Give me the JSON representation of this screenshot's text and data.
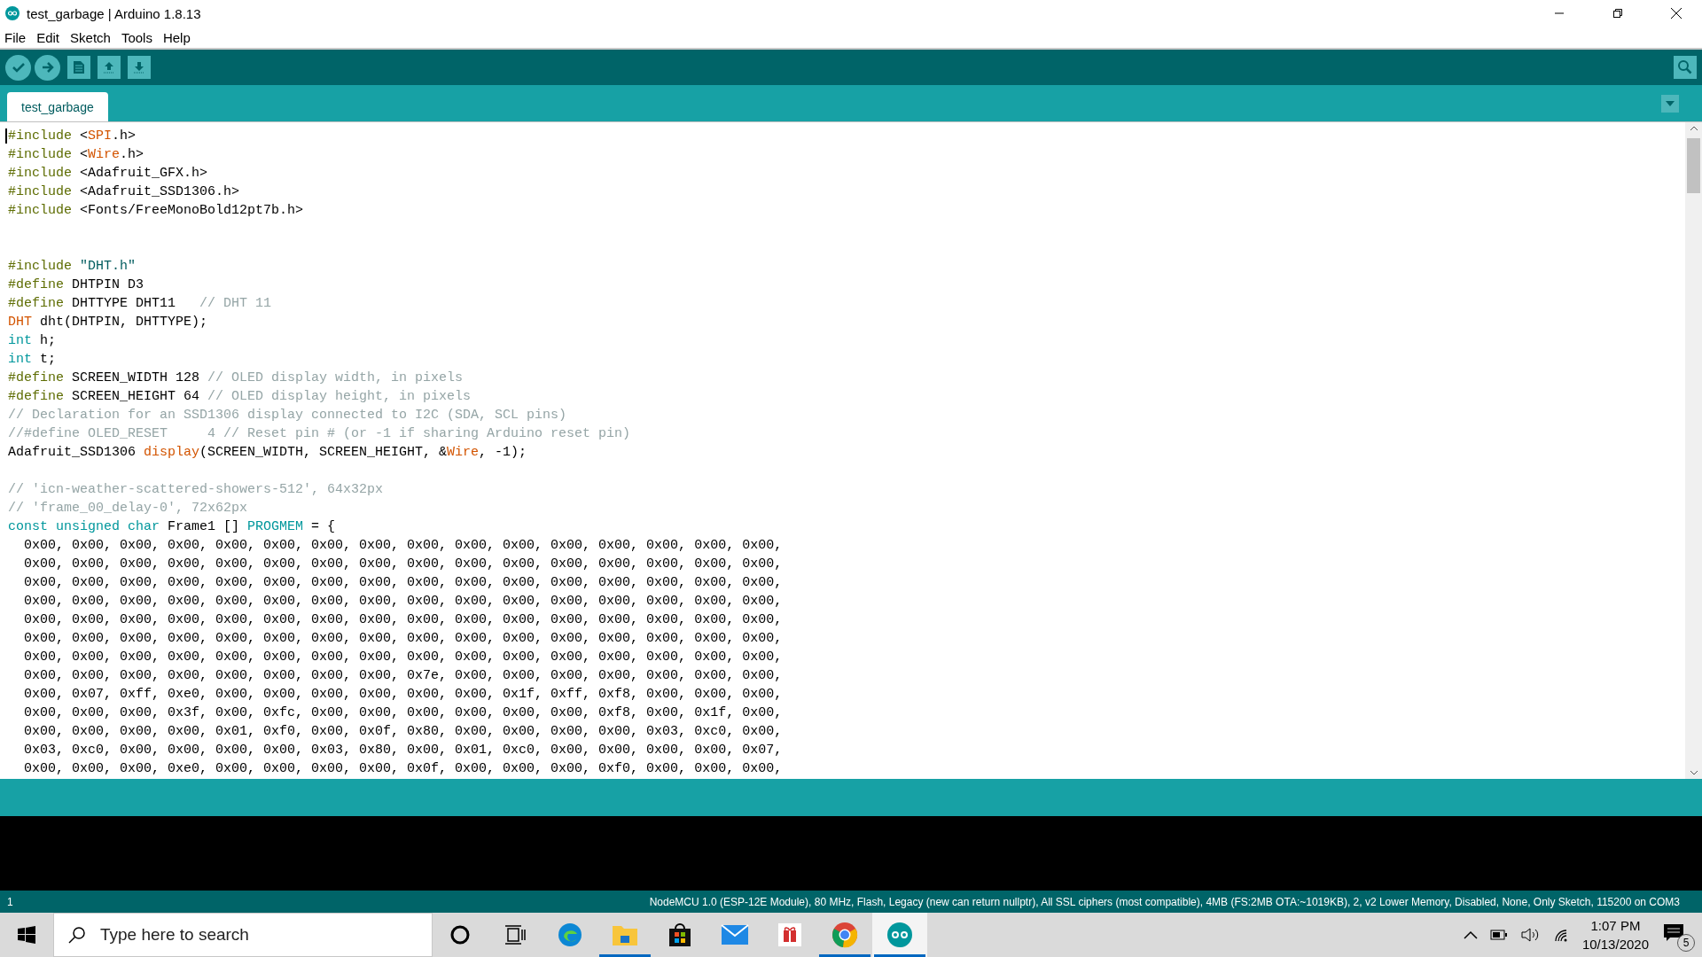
{
  "window": {
    "title": "test_garbage | Arduino 1.8.13"
  },
  "menu": [
    "File",
    "Edit",
    "Sketch",
    "Tools",
    "Help"
  ],
  "tabs": [
    {
      "label": "test_garbage",
      "selected": true
    }
  ],
  "editor": {
    "lines": [
      {
        "kind": "code",
        "tokens": [
          {
            "kind": "directive",
            "text": "#include"
          },
          {
            "kind": "plain",
            "text": " <"
          },
          {
            "kind": "lib",
            "text": "SPI"
          },
          {
            "kind": "plain",
            "text": ".h>"
          }
        ]
      },
      {
        "kind": "code",
        "tokens": [
          {
            "kind": "directive",
            "text": "#include"
          },
          {
            "kind": "plain",
            "text": " <"
          },
          {
            "kind": "lib",
            "text": "Wire"
          },
          {
            "kind": "plain",
            "text": ".h>"
          }
        ]
      },
      {
        "kind": "code",
        "tokens": [
          {
            "kind": "directive",
            "text": "#include"
          },
          {
            "kind": "plain",
            "text": " <Adafruit_GFX.h>"
          }
        ]
      },
      {
        "kind": "code",
        "tokens": [
          {
            "kind": "directive",
            "text": "#include"
          },
          {
            "kind": "plain",
            "text": " <Adafruit_SSD1306.h>"
          }
        ]
      },
      {
        "kind": "code",
        "tokens": [
          {
            "kind": "directive",
            "text": "#include"
          },
          {
            "kind": "plain",
            "text": " <Fonts/FreeMonoBold12pt7b.h>"
          }
        ]
      },
      {
        "kind": "blank"
      },
      {
        "kind": "blank"
      },
      {
        "kind": "code",
        "tokens": [
          {
            "kind": "directive",
            "text": "#include"
          },
          {
            "kind": "string",
            "text": " \"DHT.h\""
          }
        ]
      },
      {
        "kind": "code",
        "tokens": [
          {
            "kind": "directive",
            "text": "#define"
          },
          {
            "kind": "plain",
            "text": " DHTPIN D3"
          }
        ]
      },
      {
        "kind": "code",
        "tokens": [
          {
            "kind": "directive",
            "text": "#define"
          },
          {
            "kind": "plain",
            "text": " DHTTYPE DHT11   "
          },
          {
            "kind": "comment",
            "text": "// DHT 11"
          }
        ]
      },
      {
        "kind": "code",
        "tokens": [
          {
            "kind": "lib",
            "text": "DHT"
          },
          {
            "kind": "plain",
            "text": " dht(DHTPIN, DHTTYPE);"
          }
        ]
      },
      {
        "kind": "code",
        "tokens": [
          {
            "kind": "type",
            "text": "int"
          },
          {
            "kind": "plain",
            "text": " h;"
          }
        ]
      },
      {
        "kind": "code",
        "tokens": [
          {
            "kind": "type",
            "text": "int"
          },
          {
            "kind": "plain",
            "text": " t;"
          }
        ]
      },
      {
        "kind": "code",
        "tokens": [
          {
            "kind": "directive",
            "text": "#define"
          },
          {
            "kind": "plain",
            "text": " SCREEN_WIDTH 128 "
          },
          {
            "kind": "comment",
            "text": "// OLED display width, in pixels"
          }
        ]
      },
      {
        "kind": "code",
        "tokens": [
          {
            "kind": "directive",
            "text": "#define"
          },
          {
            "kind": "plain",
            "text": " SCREEN_HEIGHT 64 "
          },
          {
            "kind": "comment",
            "text": "// OLED display height, in pixels"
          }
        ]
      },
      {
        "kind": "code",
        "tokens": [
          {
            "kind": "comment",
            "text": "// Declaration for an SSD1306 display connected to I2C (SDA, SCL pins)"
          }
        ]
      },
      {
        "kind": "code",
        "tokens": [
          {
            "kind": "comment",
            "text": "//#define OLED_RESET     4 // Reset pin # (or -1 if sharing Arduino reset pin)"
          }
        ]
      },
      {
        "kind": "code",
        "tokens": [
          {
            "kind": "plain",
            "text": "Adafruit_SSD1306 "
          },
          {
            "kind": "lib",
            "text": "display"
          },
          {
            "kind": "plain",
            "text": "(SCREEN_WIDTH, SCREEN_HEIGHT, &"
          },
          {
            "kind": "lib",
            "text": "Wire"
          },
          {
            "kind": "plain",
            "text": ", -1);"
          }
        ]
      },
      {
        "kind": "blank"
      },
      {
        "kind": "code",
        "tokens": [
          {
            "kind": "comment",
            "text": "// 'icn-weather-scattered-showers-512', 64x32px"
          }
        ]
      },
      {
        "kind": "code",
        "tokens": [
          {
            "kind": "comment",
            "text": "// 'frame_00_delay-0', 72x62px"
          }
        ]
      },
      {
        "kind": "code",
        "tokens": [
          {
            "kind": "type",
            "text": "const unsigned char"
          },
          {
            "kind": "plain",
            "text": " Frame1 [] "
          },
          {
            "kind": "type",
            "text": "PROGMEM"
          },
          {
            "kind": "plain",
            "text": " = {"
          }
        ]
      },
      {
        "kind": "code",
        "tokens": [
          {
            "kind": "plain",
            "text": "  0x00, 0x00, 0x00, 0x00, 0x00, 0x00, 0x00, 0x00, 0x00, 0x00, 0x00, 0x00, 0x00, 0x00, 0x00, 0x00,"
          }
        ]
      },
      {
        "kind": "code",
        "tokens": [
          {
            "kind": "plain",
            "text": "  0x00, 0x00, 0x00, 0x00, 0x00, 0x00, 0x00, 0x00, 0x00, 0x00, 0x00, 0x00, 0x00, 0x00, 0x00, 0x00,"
          }
        ]
      },
      {
        "kind": "code",
        "tokens": [
          {
            "kind": "plain",
            "text": "  0x00, 0x00, 0x00, 0x00, 0x00, 0x00, 0x00, 0x00, 0x00, 0x00, 0x00, 0x00, 0x00, 0x00, 0x00, 0x00,"
          }
        ]
      },
      {
        "kind": "code",
        "tokens": [
          {
            "kind": "plain",
            "text": "  0x00, 0x00, 0x00, 0x00, 0x00, 0x00, 0x00, 0x00, 0x00, 0x00, 0x00, 0x00, 0x00, 0x00, 0x00, 0x00,"
          }
        ]
      },
      {
        "kind": "code",
        "tokens": [
          {
            "kind": "plain",
            "text": "  0x00, 0x00, 0x00, 0x00, 0x00, 0x00, 0x00, 0x00, 0x00, 0x00, 0x00, 0x00, 0x00, 0x00, 0x00, 0x00,"
          }
        ]
      },
      {
        "kind": "code",
        "tokens": [
          {
            "kind": "plain",
            "text": "  0x00, 0x00, 0x00, 0x00, 0x00, 0x00, 0x00, 0x00, 0x00, 0x00, 0x00, 0x00, 0x00, 0x00, 0x00, 0x00,"
          }
        ]
      },
      {
        "kind": "code",
        "tokens": [
          {
            "kind": "plain",
            "text": "  0x00, 0x00, 0x00, 0x00, 0x00, 0x00, 0x00, 0x00, 0x00, 0x00, 0x00, 0x00, 0x00, 0x00, 0x00, 0x00,"
          }
        ]
      },
      {
        "kind": "code",
        "tokens": [
          {
            "kind": "plain",
            "text": "  0x00, 0x00, 0x00, 0x00, 0x00, 0x00, 0x00, 0x00, 0x7e, 0x00, 0x00, 0x00, 0x00, 0x00, 0x00, 0x00,"
          }
        ]
      },
      {
        "kind": "code",
        "tokens": [
          {
            "kind": "plain",
            "text": "  0x00, 0x07, 0xff, 0xe0, 0x00, 0x00, 0x00, 0x00, 0x00, 0x00, 0x1f, 0xff, 0xf8, 0x00, 0x00, 0x00,"
          }
        ]
      },
      {
        "kind": "code",
        "tokens": [
          {
            "kind": "plain",
            "text": "  0x00, 0x00, 0x00, 0x3f, 0x00, 0xfc, 0x00, 0x00, 0x00, 0x00, 0x00, 0x00, 0xf8, 0x00, 0x1f, 0x00,"
          }
        ]
      },
      {
        "kind": "code",
        "tokens": [
          {
            "kind": "plain",
            "text": "  0x00, 0x00, 0x00, 0x00, 0x01, 0xf0, 0x00, 0x0f, 0x80, 0x00, 0x00, 0x00, 0x00, 0x03, 0xc0, 0x00,"
          }
        ]
      },
      {
        "kind": "code",
        "tokens": [
          {
            "kind": "plain",
            "text": "  0x03, 0xc0, 0x00, 0x00, 0x00, 0x00, 0x03, 0x80, 0x00, 0x01, 0xc0, 0x00, 0x00, 0x00, 0x00, 0x07,"
          }
        ]
      },
      {
        "kind": "code",
        "tokens": [
          {
            "kind": "plain",
            "text": "  0x00, 0x00, 0x00, 0xe0, 0x00, 0x00, 0x00, 0x00, 0x0f, 0x00, 0x00, 0x00, 0xf0, 0x00, 0x00, 0x00,"
          }
        ]
      }
    ]
  },
  "status_bar": {
    "line": "1",
    "board": "NodeMCU 1.0 (ESP-12E Module), 80 MHz, Flash, Legacy (new can return nullptr), All SSL ciphers (most compatible), 4MB (FS:2MB OTA:~1019KB), 2, v2 Lower Memory, Disabled, None, Only Sketch, 115200 on COM3"
  },
  "taskbar": {
    "search": {
      "placeholder": "Type here to search"
    },
    "apps": [
      {
        "kind": "edge",
        "running": false,
        "selected": false
      },
      {
        "kind": "explorer",
        "running": true,
        "selected": false
      },
      {
        "kind": "store",
        "running": false,
        "selected": false
      },
      {
        "kind": "mail",
        "running": false,
        "selected": false
      },
      {
        "kind": "gift",
        "running": false,
        "selected": false
      },
      {
        "kind": "chrome",
        "running": true,
        "selected": false
      },
      {
        "kind": "arduino",
        "running": true,
        "selected": true
      }
    ],
    "time": "1:07 PM",
    "date": "10/13/2020",
    "notifications": "5"
  }
}
